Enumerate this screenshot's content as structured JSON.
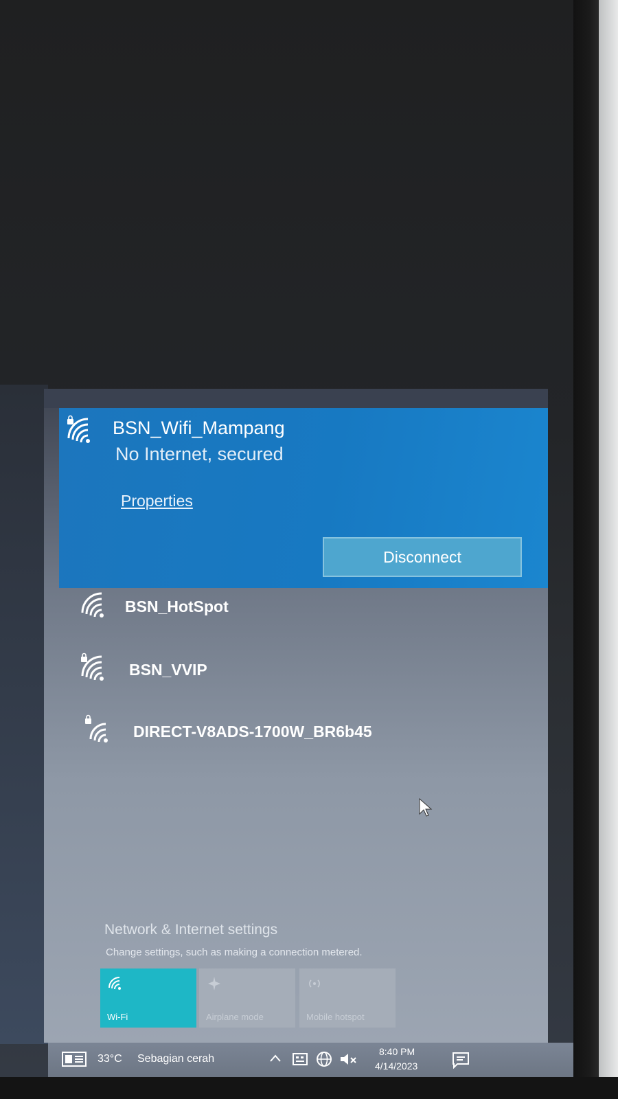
{
  "flyout": {
    "connected": {
      "ssid": "BSN_Wifi_Mampang",
      "status": "No Internet, secured",
      "properties_link": "Properties",
      "disconnect_label": "Disconnect"
    },
    "networks": [
      {
        "ssid": "BSN_HotSpot",
        "secured": false
      },
      {
        "ssid": "BSN_VVIP",
        "secured": true
      },
      {
        "ssid": "DIRECT-V8ADS-1700W_BR6b45",
        "secured": true
      }
    ],
    "settings": {
      "title": "Network & Internet settings",
      "description": "Change settings, such as making a connection metered."
    },
    "quick_actions": [
      {
        "label": "Wi-Fi",
        "active": true,
        "icon": "wifi-icon"
      },
      {
        "label": "Airplane mode",
        "active": false,
        "icon": "airplane-icon"
      },
      {
        "label": "Mobile hotspot",
        "active": false,
        "icon": "hotspot-icon"
      }
    ]
  },
  "taskbar": {
    "weather_temp": "33°C",
    "weather_desc": "Sebagian cerah",
    "time": "8:40 PM",
    "date": "4/14/2023"
  },
  "colors": {
    "accent": "#1779c2",
    "wifi_tile": "#1eb7c6",
    "taskbar": "#747e8d"
  }
}
